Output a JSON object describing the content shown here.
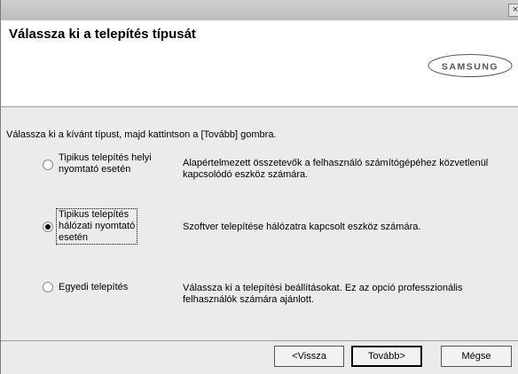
{
  "window": {
    "close_label": "×"
  },
  "header": {
    "title": "Válassza ki a telepítés típusát",
    "brand": "SAMSUNG"
  },
  "instruction": "Válassza ki a kívánt típust, majd kattintson a [Tovább] gombra.",
  "options": [
    {
      "label": "Tipikus telepítés helyi\nnyomtató esetén",
      "description": "Alapértelmezett összetevők a felhasználó számítógépéhez közvetlenül kapcsolódó eszköz számára.",
      "selected": false
    },
    {
      "label": "Tipikus telepítés\nhálózati nyomtató\nesetén",
      "description": "Szoftver telepítése hálózatra kapcsolt eszköz számára.",
      "selected": true
    },
    {
      "label": "Egyedi telepítés",
      "description": "Válassza ki a telepítési beállításokat. Ez az opció professzionális felhasználók számára ajánlott.",
      "selected": false
    }
  ],
  "buttons": {
    "back": "<Vissza",
    "next": "Tovább>",
    "cancel": "Mégse"
  }
}
